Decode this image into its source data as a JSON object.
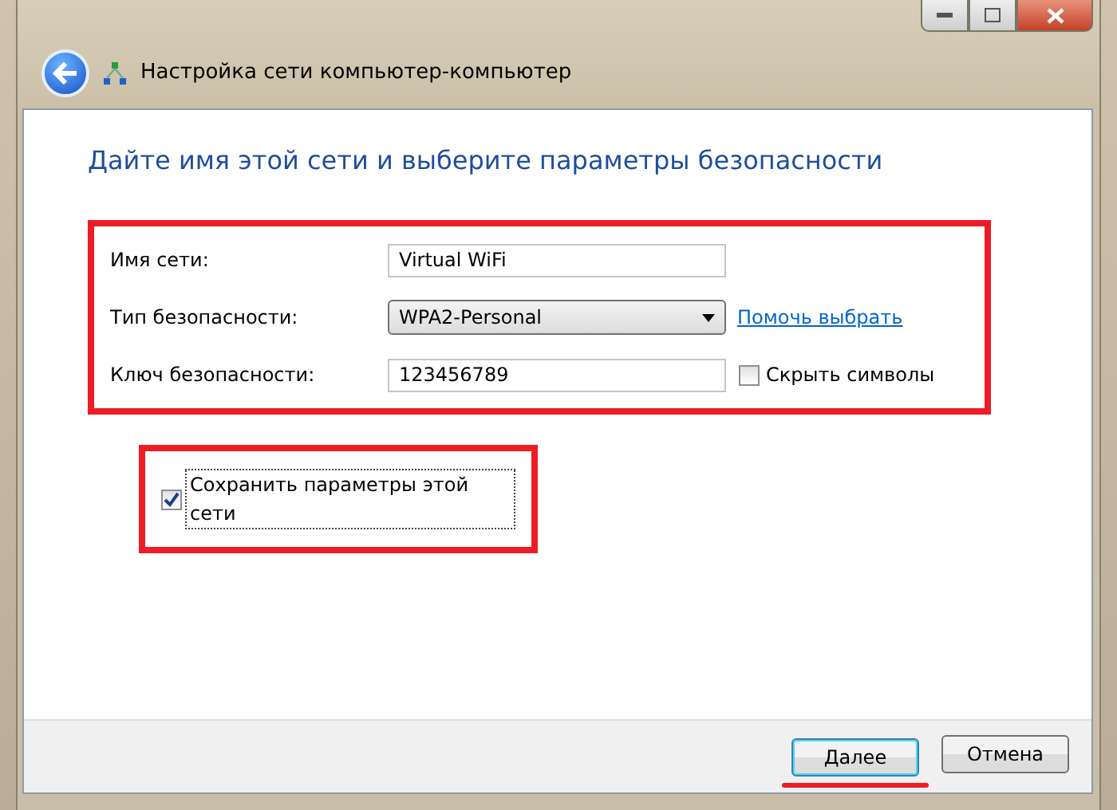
{
  "window": {
    "title": "Настройка сети компьютер-компьютер"
  },
  "heading": "Дайте имя этой сети и выберите параметры безопасности",
  "fields": [
    {
      "kind": "text",
      "label": "Имя сети:",
      "value": "Virtual WiFi"
    },
    {
      "kind": "select",
      "label": "Тип безопасности:",
      "value": "WPA2-Personal",
      "link": "Помочь выбрать"
    },
    {
      "kind": "text",
      "label": "Ключ безопасности:",
      "value": "123456789",
      "checkbox": {
        "label": "Скрыть символы",
        "checked": false
      }
    }
  ],
  "save_settings": {
    "label": "Сохранить параметры этой сети",
    "checked": true
  },
  "buttons": [
    {
      "label": "Далее",
      "default": true
    },
    {
      "label": "Отмена",
      "default": false
    }
  ]
}
